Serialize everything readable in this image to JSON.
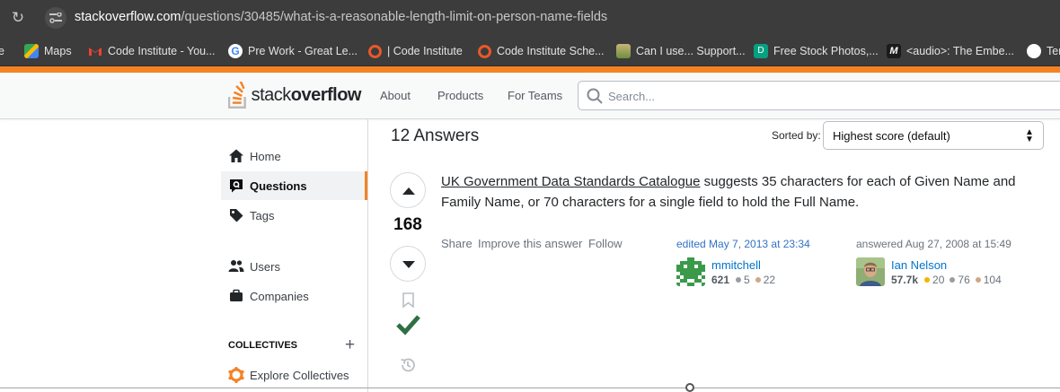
{
  "browser": {
    "url_host": "stackoverflow.com",
    "url_path": "/questions/30485/what-is-a-reasonable-length-limit-on-person-name-fields",
    "bookmarks": [
      {
        "label": "e",
        "icon": "unknown-icon"
      },
      {
        "label": "Maps",
        "icon": "maps-icon"
      },
      {
        "label": "Code Institute - You...",
        "icon": "gmail-icon"
      },
      {
        "label": "Pre Work - Great Le...",
        "icon": "google-icon"
      },
      {
        "label": "| Code Institute",
        "icon": "code-institute-icon"
      },
      {
        "label": "Code Institute Sche...",
        "icon": "code-institute-icon"
      },
      {
        "label": "Can I use... Support...",
        "icon": "caniuse-icon"
      },
      {
        "label": "Free Stock Photos,...",
        "icon": "stock-photos-icon"
      },
      {
        "label": "<audio>: The Embe...",
        "icon": "mdn-icon"
      },
      {
        "label": "Ter",
        "icon": "github-icon"
      }
    ]
  },
  "header": {
    "logo_light": "stack",
    "logo_bold": "overflow",
    "nav": [
      "About",
      "Products",
      "For Teams"
    ],
    "search_placeholder": "Search..."
  },
  "sidebar": {
    "items": [
      {
        "label": "Home",
        "icon": "home-icon"
      },
      {
        "label": "Questions",
        "icon": "questions-icon",
        "active": true
      },
      {
        "label": "Tags",
        "icon": "tag-icon"
      },
      {
        "label": "Users",
        "icon": "users-icon"
      },
      {
        "label": "Companies",
        "icon": "briefcase-icon"
      }
    ],
    "collectives_heading": "COLLECTIVES",
    "explore_collectives": "Explore Collectives"
  },
  "answers": {
    "count_label": "12 Answers",
    "sorted_by_label": "Sorted by:",
    "sort_value": "Highest score (default)"
  },
  "answer": {
    "score": "168",
    "accepted": true,
    "link_text": "UK Government Data Standards Catalogue",
    "body_rest": " suggests 35 characters for each of Given Name and Family Name, or 70 characters for a single field to hold the Full Name.",
    "menu": [
      "Share",
      "Improve this answer",
      "Follow"
    ],
    "editor": {
      "action": "edited May 7, 2013 at 23:34",
      "name": "mmitchell",
      "rep": "621",
      "silver": "5",
      "bronze": "22"
    },
    "author": {
      "action": "answered Aug 27, 2008 at 15:49",
      "name": "Ian Nelson",
      "rep": "57.7k",
      "gold": "20",
      "silver": "76",
      "bronze": "104"
    }
  },
  "colors": {
    "accent": "#f48225",
    "link": "#0074cc",
    "accepted": "#2f6f44",
    "gold": "#f1b600",
    "silver": "#9a9c9f",
    "bronze": "#d1a684"
  }
}
